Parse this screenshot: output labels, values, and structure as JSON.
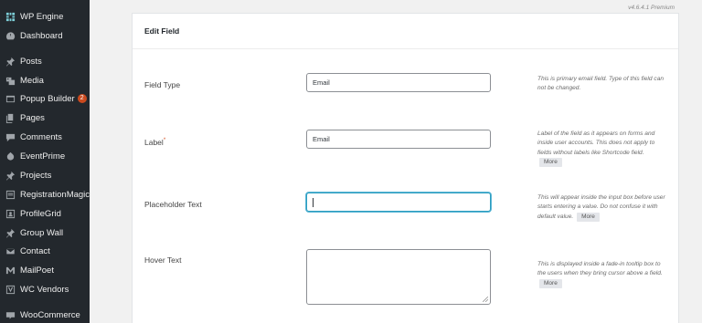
{
  "sidebar": {
    "items": [
      {
        "label": "WP Engine",
        "icon": "wp-engine-icon"
      },
      {
        "label": "Dashboard",
        "icon": "dashboard-icon"
      },
      {
        "label": "Posts",
        "icon": "pushpin-icon"
      },
      {
        "label": "Media",
        "icon": "media-icon"
      },
      {
        "label": "Popup Builder",
        "icon": "popup-icon",
        "badge": "2"
      },
      {
        "label": "Pages",
        "icon": "pages-icon"
      },
      {
        "label": "Comments",
        "icon": "comments-icon"
      },
      {
        "label": "EventPrime",
        "icon": "event-icon"
      },
      {
        "label": "Projects",
        "icon": "pushpin-icon"
      },
      {
        "label": "RegistrationMagic",
        "icon": "form-icon"
      },
      {
        "label": "ProfileGrid",
        "icon": "profile-icon"
      },
      {
        "label": "Group Wall",
        "icon": "pushpin-icon"
      },
      {
        "label": "Contact",
        "icon": "mail-icon"
      },
      {
        "label": "MailPoet",
        "icon": "mailpoet-icon"
      },
      {
        "label": "WC Vendors",
        "icon": "vendors-icon"
      },
      {
        "label": "WooCommerce",
        "icon": "woo-icon"
      }
    ]
  },
  "version": "v4.6.4.1 Premium",
  "panel": {
    "title": "Edit Field",
    "more_label": "More",
    "fields": [
      {
        "label": "Field Type",
        "value": "Email",
        "help": "This is primary email field. Type of this field can not be changed."
      },
      {
        "label": "Label",
        "required_mark": "*",
        "value": "Email",
        "help": "Label of the field as it appears on forms and inside user accounts. This does not apply to fields without labels like Shortcode field."
      },
      {
        "label": "Placeholder Text",
        "value": "",
        "help": "This will appear inside the input box before user starts entering a value. Do not confuse it with default value."
      },
      {
        "label": "Hover Text",
        "value": "",
        "help": "This is displayed inside a fade-in tooltip box to the users when they bring cursor above a field."
      }
    ]
  }
}
